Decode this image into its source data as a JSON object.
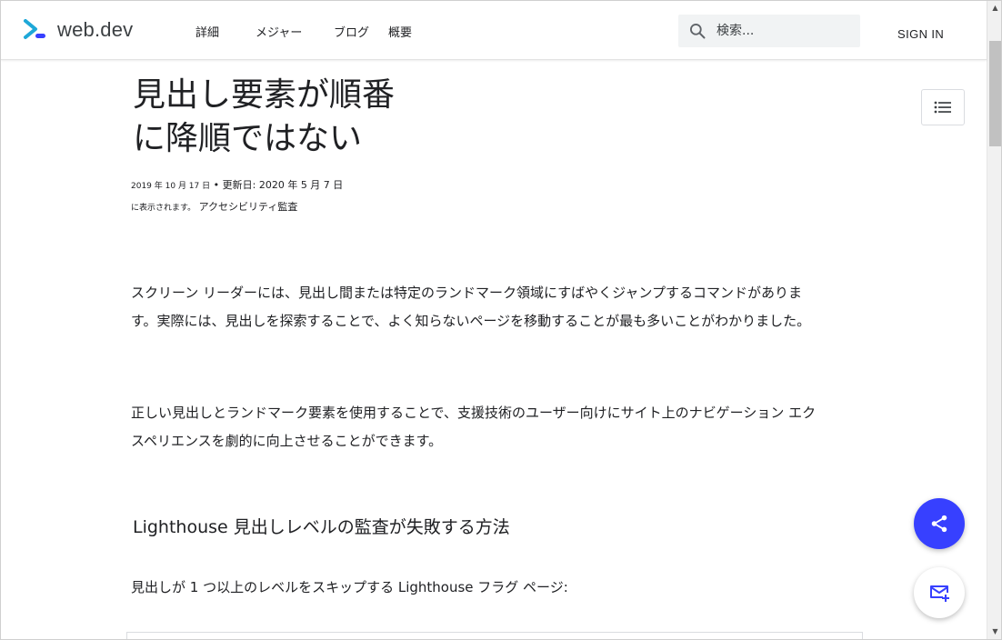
{
  "header": {
    "logo_text": "web.dev",
    "nav": [
      "詳細",
      "メジャー",
      "ブログ",
      "概要"
    ],
    "search_placeholder": "検索...",
    "signin": "SIGN IN"
  },
  "article": {
    "title": "見出し要素が順番に降順ではない",
    "meta_line1_date": "2019 年 10 月 17 日",
    "meta_line1_sep": "•",
    "meta_line1_updated": "更新日: 2020 年 5 月 7 日",
    "meta_line2_prefix": "に表示されます。",
    "meta_line2_link": "アクセシビリティ監査",
    "paragraph1": "スクリーン リーダーには、見出し間または特定のランドマーク領域にすばやくジャンプするコマンドがあります。実際には、見出しを探索することで、よく知らないページを移動することが最も多いことがわかりました。",
    "paragraph2": "正しい見出しとランドマーク要素を使用することで、支援技術のユーザー向けにサイト上のナビゲーション エクスペリエンスを劇的に向上させることができます。",
    "heading2": "Lighthouse 見出しレベルの監査が失敗する方法",
    "paragraph3": "見出しが 1 つ以上のレベルをスキップする Lighthouse フラグ ページ:"
  },
  "icons": {
    "logo": "web-dev-chevron-logo",
    "search": "search-icon",
    "toc": "table-of-contents-icon",
    "share": "share-icon",
    "mail": "mail-subscribe-icon"
  },
  "colors": {
    "accent": "#3740ff",
    "logo_cyan": "#1ea8d8",
    "text": "#202124"
  }
}
